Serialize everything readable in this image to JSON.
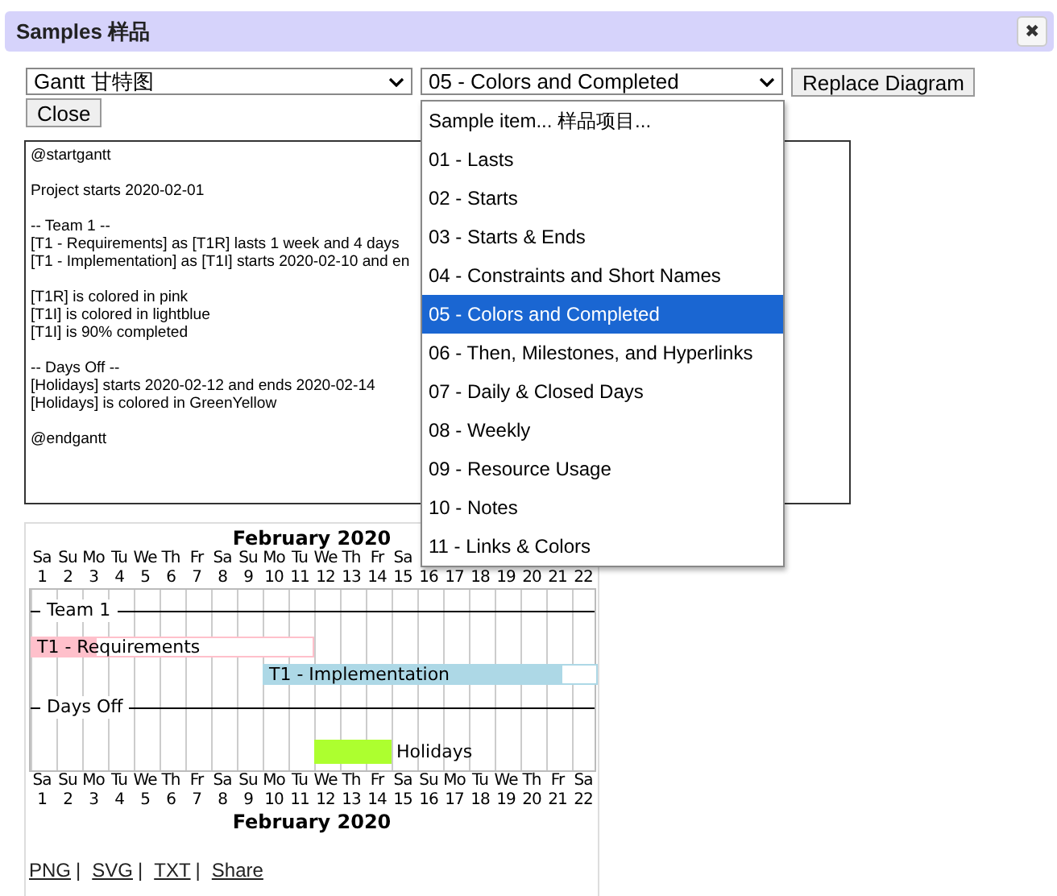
{
  "dialog": {
    "title": "Samples 样品",
    "close_symbol": "✖"
  },
  "diagram_type": {
    "value": "Gantt 甘特图"
  },
  "sample": {
    "value": "05 - Colors and Completed",
    "expanded": true
  },
  "buttons": [
    "Replace Diagram",
    "Close"
  ],
  "editor": {
    "blocks": [
      [
        "@startgantt"
      ],
      [
        "Project starts 2020-02-01"
      ],
      [
        "-- Team 1 --",
        "[T1 - Requirements] as [T1R] lasts 1 week and 4 days",
        "[T1 - Implementation] as [T1I] starts 2020-02-10 and en"
      ],
      [
        "[T1R] is colored in pink",
        "[T1I] is colored in lightblue",
        "[T1I] is 90% completed"
      ],
      [
        "-- Days Off --",
        "[Holidays] starts 2020-02-12 and ends 2020-02-14",
        "[Holidays] is colored in GreenYellow"
      ],
      [
        "@endgantt"
      ]
    ]
  },
  "sample_options": [
    {
      "label": "Sample item... 样品项目...",
      "selected": false
    },
    {
      "label": "01 - Lasts",
      "selected": false
    },
    {
      "label": "02 - Starts",
      "selected": false
    },
    {
      "label": "03 - Starts & Ends",
      "selected": false
    },
    {
      "label": "04 - Constraints and Short Names",
      "selected": false
    },
    {
      "label": "05 - Colors and Completed",
      "selected": true
    },
    {
      "label": "06 - Then, Milestones, and Hyperlinks",
      "selected": false
    },
    {
      "label": "07 - Daily & Closed Days",
      "selected": false
    },
    {
      "label": "08 - Weekly",
      "selected": false
    },
    {
      "label": "09 - Resource Usage",
      "selected": false
    },
    {
      "label": "10 - Notes",
      "selected": false
    },
    {
      "label": "11 - Links & Colors",
      "selected": false
    }
  ],
  "gantt": {
    "month_top": "February 2020",
    "month_bottom": "February 2020",
    "days_top": [
      {
        "weekday": "Sa",
        "date": "1"
      },
      {
        "weekday": "Su",
        "date": "2"
      },
      {
        "weekday": "Mo",
        "date": "3"
      },
      {
        "weekday": "Tu",
        "date": "4"
      },
      {
        "weekday": "We",
        "date": "5"
      },
      {
        "weekday": "Th",
        "date": "6"
      },
      {
        "weekday": "Fr",
        "date": "7"
      },
      {
        "weekday": "Sa",
        "date": "8"
      },
      {
        "weekday": "Su",
        "date": "9"
      },
      {
        "weekday": "Mo",
        "date": "10"
      },
      {
        "weekday": "Tu",
        "date": "11"
      },
      {
        "weekday": "We",
        "date": "12"
      },
      {
        "weekday": "Th",
        "date": "13"
      },
      {
        "weekday": "Fr",
        "date": "14"
      },
      {
        "weekday": "Sa",
        "date": "15"
      },
      {
        "date": "16"
      },
      {
        "date": "17"
      },
      {
        "date": "18"
      },
      {
        "date": "19"
      },
      {
        "date": "20"
      },
      {
        "date": "21"
      },
      {
        "date": "22"
      }
    ],
    "rows": [
      {
        "kind": "separator",
        "label": "Team 1"
      },
      {
        "kind": "task",
        "label": "T1 - Requirements",
        "color": "#ffc0cb",
        "level": 0.23,
        "span": [
          true,
          true,
          true,
          true,
          true,
          true,
          true,
          true,
          true,
          true,
          true,
          false,
          false,
          false,
          false,
          false,
          false,
          false,
          false,
          false,
          false,
          false
        ]
      },
      {
        "kind": "task",
        "label": "T1 - Implementation",
        "color": "#add8e6",
        "level": 0.9,
        "span": [
          false,
          false,
          false,
          false,
          false,
          false,
          false,
          false,
          false,
          true,
          true,
          true,
          true,
          true,
          true,
          true,
          true,
          true,
          true,
          true,
          true,
          true
        ]
      },
      {
        "kind": "separator",
        "label": "Days Off"
      },
      {
        "kind": "task",
        "label": "Holidays",
        "color": "#adff2f",
        "level": 1,
        "span": [
          false,
          false,
          false,
          false,
          false,
          false,
          false,
          false,
          false,
          false,
          false,
          true,
          true,
          true,
          false,
          false,
          false,
          false,
          false,
          false,
          false,
          false
        ]
      }
    ],
    "days_bottom": [
      {
        "weekday": "Sa",
        "date": "1"
      },
      {
        "weekday": "Su",
        "date": "2"
      },
      {
        "weekday": "Mo",
        "date": "3"
      },
      {
        "weekday": "Tu",
        "date": "4"
      },
      {
        "weekday": "We",
        "date": "5"
      },
      {
        "weekday": "Th",
        "date": "6"
      },
      {
        "weekday": "Fr",
        "date": "7"
      },
      {
        "weekday": "Sa",
        "date": "8"
      },
      {
        "weekday": "Su",
        "date": "9"
      },
      {
        "weekday": "Mo",
        "date": "10"
      },
      {
        "weekday": "Tu",
        "date": "11"
      },
      {
        "weekday": "We",
        "date": "12"
      },
      {
        "weekday": "Th",
        "date": "13"
      },
      {
        "weekday": "Fr",
        "date": "14"
      },
      {
        "weekday": "Sa",
        "date": "15"
      },
      {
        "weekday": "Su",
        "date": "16"
      },
      {
        "weekday": "Mo",
        "date": "17"
      },
      {
        "weekday": "Tu",
        "date": "18"
      },
      {
        "weekday": "We",
        "date": "19"
      },
      {
        "weekday": "Th",
        "date": "20"
      },
      {
        "weekday": "Fr",
        "date": "21"
      },
      {
        "weekday": "Sa",
        "date": "22"
      }
    ]
  },
  "export_links": [
    {
      "label": "PNG",
      "separator": "|"
    },
    {
      "label": "SVG",
      "separator": "|"
    },
    {
      "label": "TXT",
      "separator": "|"
    },
    {
      "label": "Share"
    }
  ]
}
